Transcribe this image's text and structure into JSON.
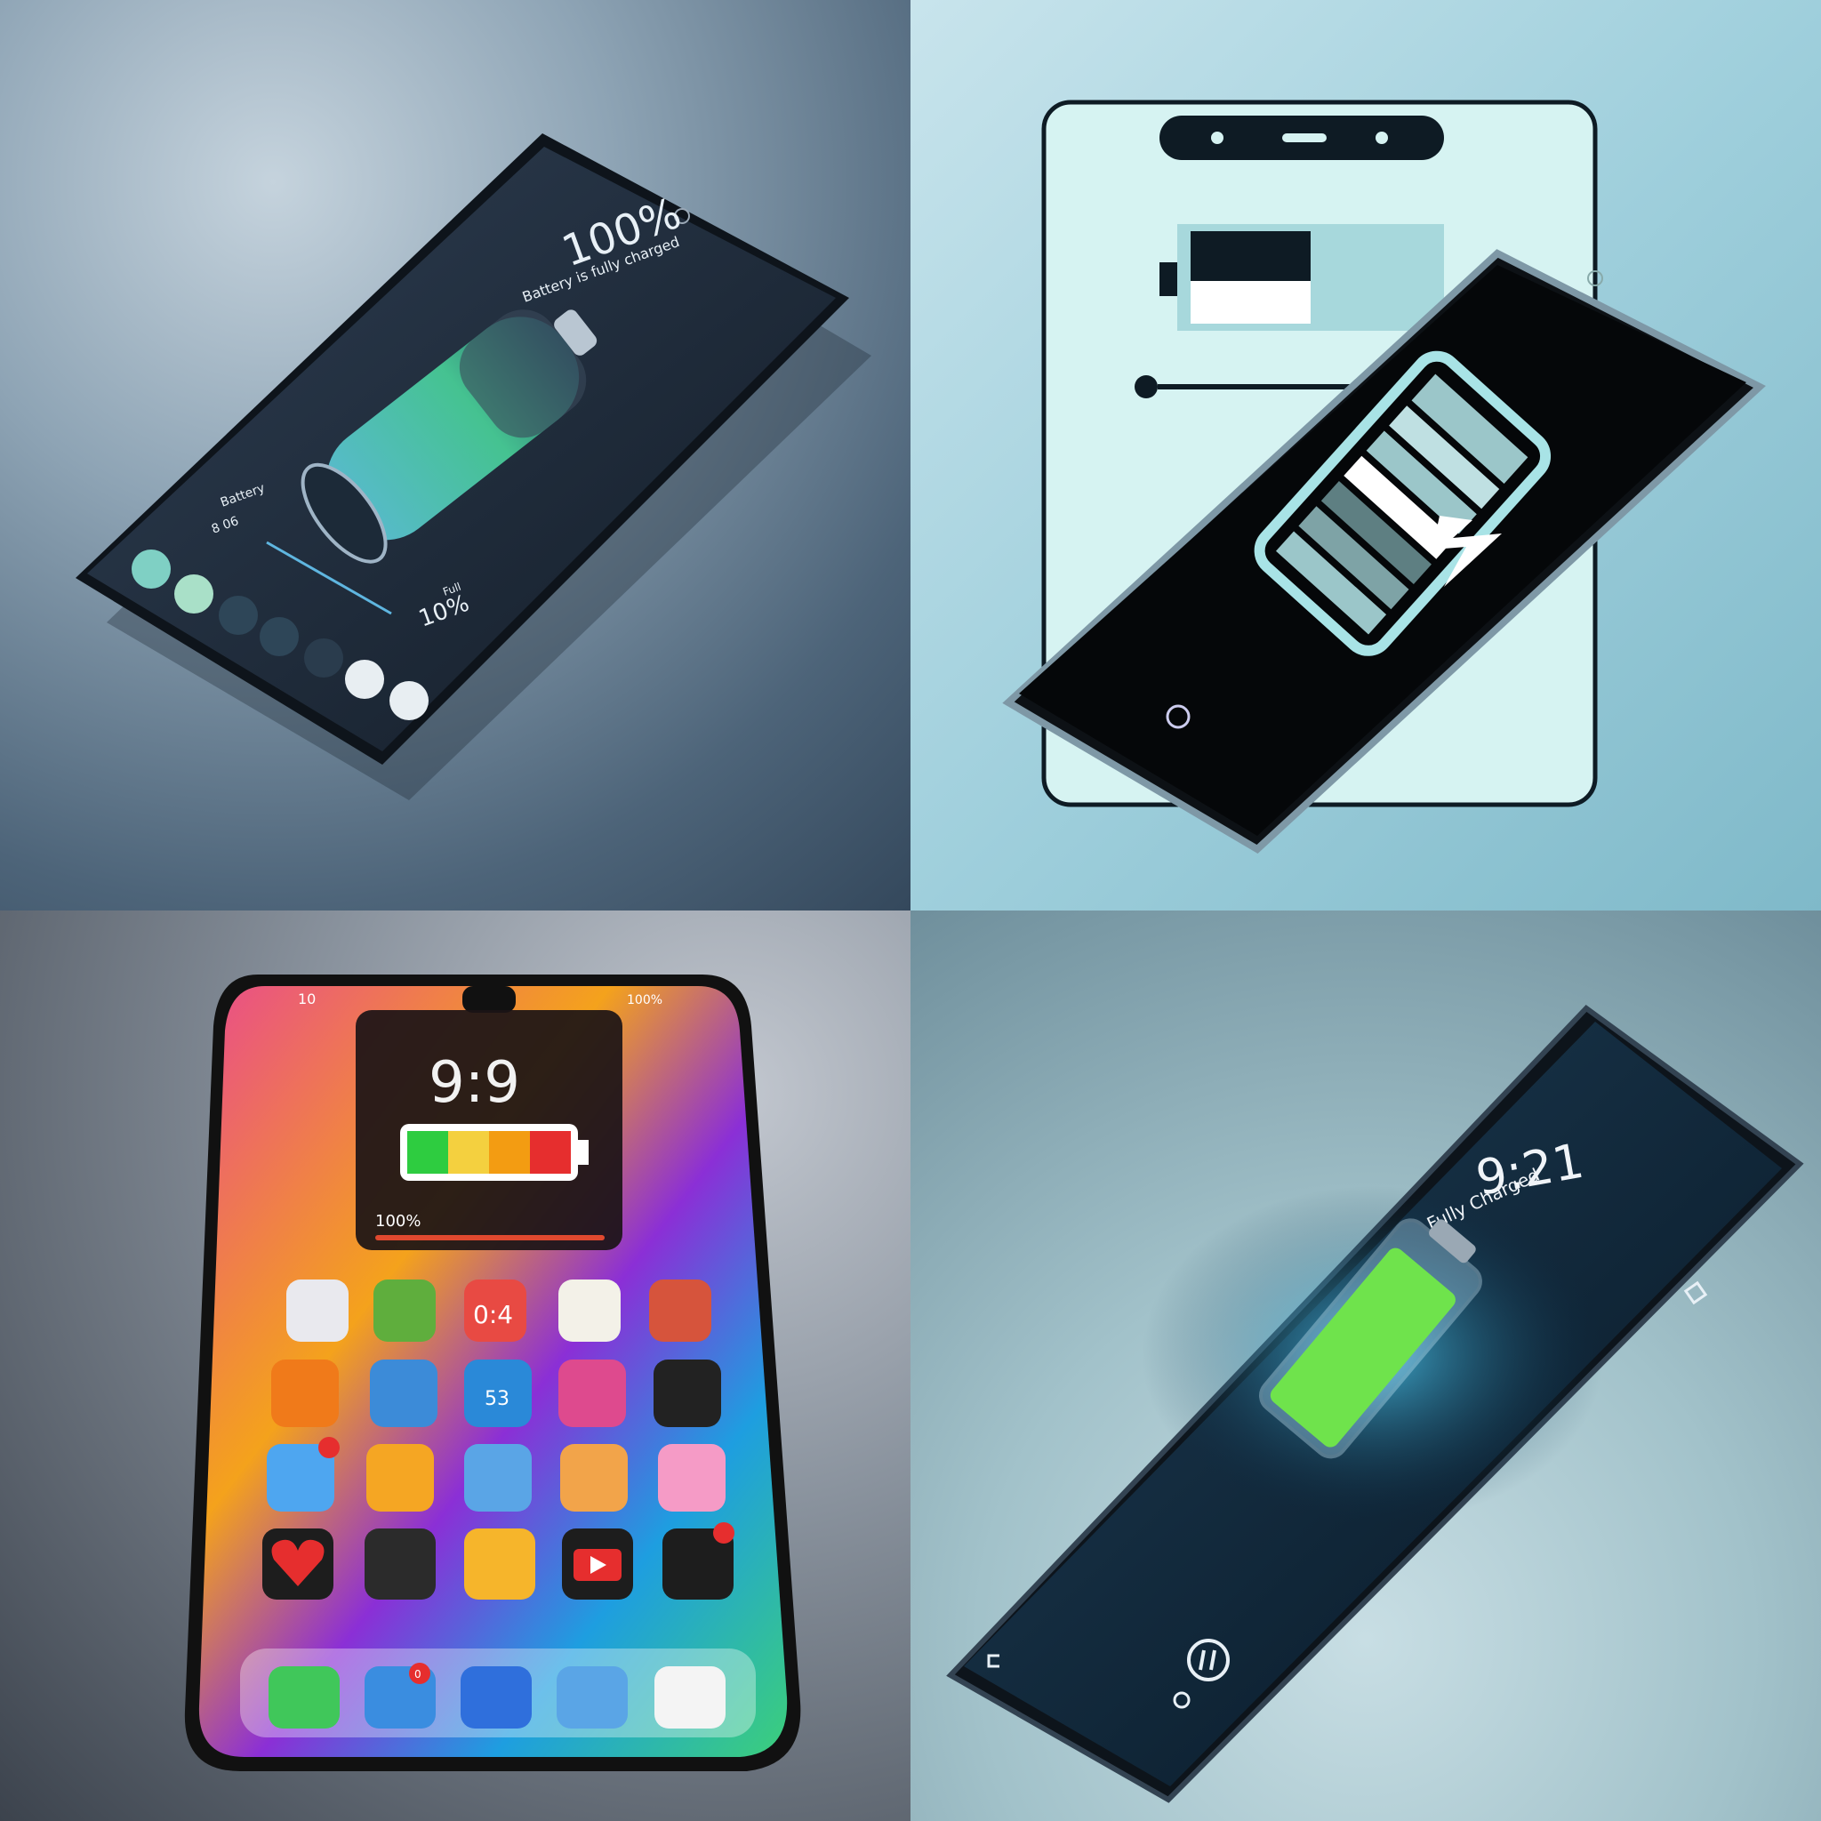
{
  "panel1": {
    "percent": "100%",
    "subtitle": "Battery is fully charged",
    "label_left": "Battery",
    "label_left_sub": "8 06",
    "small_percent": "10%",
    "small_label": "Full"
  },
  "panel2": {},
  "panel3": {
    "status_time": "10",
    "status_battery": "100%",
    "lock_time": "9:9",
    "widget_percent": "100%",
    "mini_clock": "0:4",
    "calendar_text": "53",
    "badge_count": "0",
    "battery_colors": [
      "#2ecc40",
      "#f4d03f",
      "#f39c12",
      "#e62e2e"
    ]
  },
  "panel4": {
    "time": "9:21",
    "status": "Fully Charged",
    "battery_level": 0.95
  }
}
